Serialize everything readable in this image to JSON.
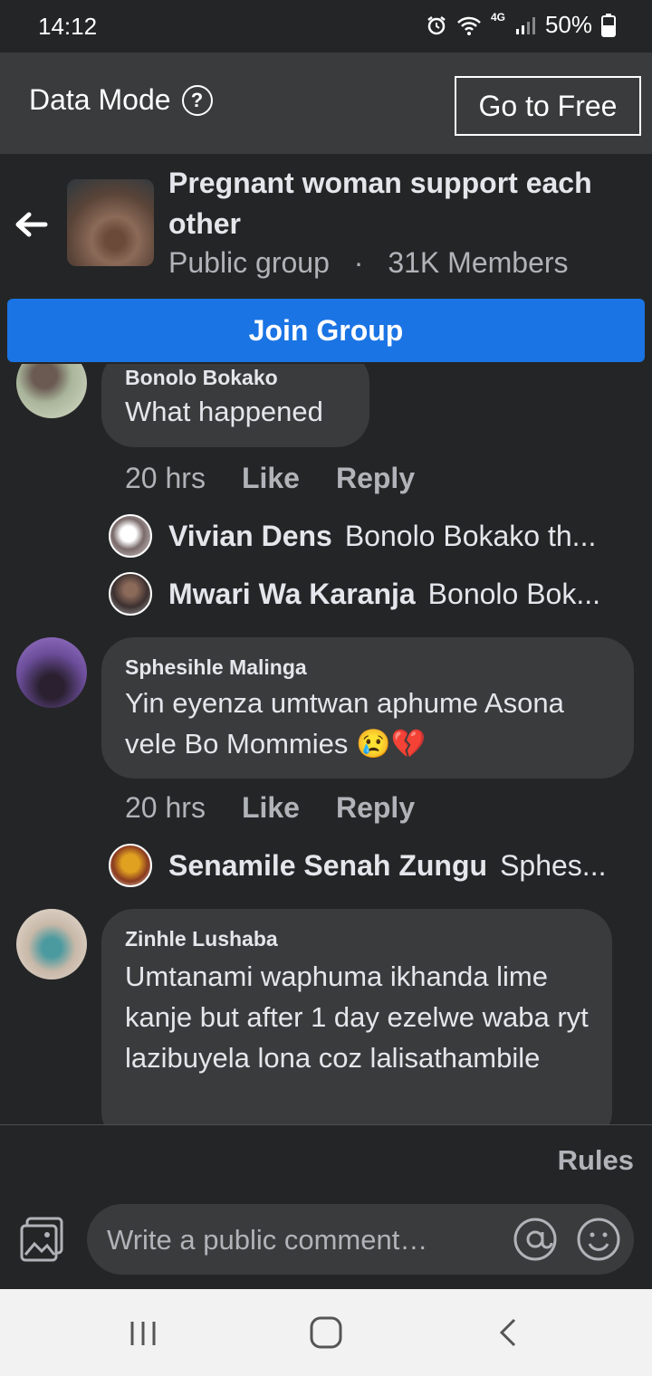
{
  "status": {
    "time": "14:12",
    "network": "4G",
    "battery": "50%"
  },
  "data_bar": {
    "label": "Data Mode",
    "button": "Go to Free"
  },
  "group": {
    "name": "Pregnant woman support each other",
    "privacy": "Public group",
    "separator": "·",
    "members": "31K Members",
    "join_label": "Join Group"
  },
  "comments": [
    {
      "author": "Bonolo Bokako",
      "text": "What happened",
      "time": "20 hrs",
      "like": "Like",
      "reply": "Reply",
      "replies": [
        {
          "name": "Vivian Dens",
          "text": "Bonolo Bokako th..."
        },
        {
          "name": "Mwari Wa Karanja",
          "text": "Bonolo Bok..."
        }
      ]
    },
    {
      "author": "Sphesihle Malinga",
      "text": "Yin eyenza umtwan aphume  Asona vele Bo Mommies 😢💔",
      "time": "20 hrs",
      "like": "Like",
      "reply": "Reply",
      "replies": [
        {
          "name": "Senamile Senah Zungu",
          "text": "Sphes..."
        }
      ]
    },
    {
      "author": "Zinhle Lushaba",
      "text": "Umtanami waphuma ikhanda lime kanje but after 1 day ezelwe waba ryt lazibuyela lona coz lalisathambile"
    }
  ],
  "footer": {
    "rules": "Rules",
    "placeholder": "Write a public comment…"
  },
  "colors": {
    "accent": "#1b74e4",
    "background": "#242526",
    "bubble": "#3a3b3c"
  }
}
